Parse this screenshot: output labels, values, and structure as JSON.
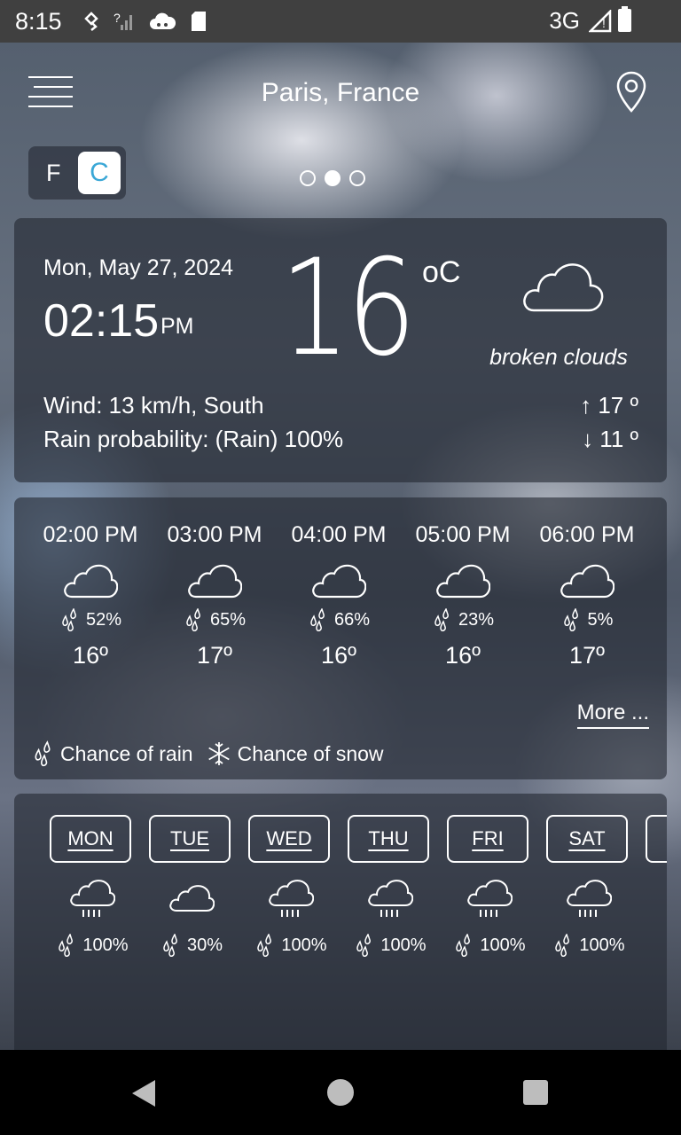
{
  "status_bar": {
    "time": "8:15",
    "network": "3G"
  },
  "header": {
    "city": "Paris, France"
  },
  "unit_toggle": {
    "f": "F",
    "c": "C",
    "selected": "C"
  },
  "pager": {
    "count": 3,
    "active_index": 1
  },
  "current": {
    "date": "Mon, May 27, 2024",
    "time": "02:15",
    "ampm": "PM",
    "temperature": "16",
    "unit": "oC",
    "condition": "broken clouds",
    "wind": "Wind: 13 km/h, South",
    "rain_probability": "Rain probability: (Rain) 100%",
    "high": "↑ 17 º",
    "low": "↓ 11 º",
    "icon": "cloud-icon"
  },
  "hourly": {
    "items": [
      {
        "time": "02:00 PM",
        "rain": "52%",
        "temp": "16º",
        "icon": "cloud-icon"
      },
      {
        "time": "03:00 PM",
        "rain": "65%",
        "temp": "17º",
        "icon": "cloud-icon"
      },
      {
        "time": "04:00 PM",
        "rain": "66%",
        "temp": "16º",
        "icon": "cloud-icon"
      },
      {
        "time": "05:00 PM",
        "rain": "23%",
        "temp": "16º",
        "icon": "cloud-icon"
      },
      {
        "time": "06:00 PM",
        "rain": "5%",
        "temp": "17º",
        "icon": "cloud-icon"
      }
    ],
    "more_label": "More ...",
    "legend_rain": "Chance of rain",
    "legend_snow": "Chance of snow"
  },
  "daily": {
    "items": [
      {
        "day": "MON",
        "rain": "100%",
        "icon": "rain-cloud-icon"
      },
      {
        "day": "TUE",
        "rain": "30%",
        "icon": "cloud-icon"
      },
      {
        "day": "WED",
        "rain": "100%",
        "icon": "rain-cloud-icon"
      },
      {
        "day": "THU",
        "rain": "100%",
        "icon": "rain-cloud-icon"
      },
      {
        "day": "FRI",
        "rain": "100%",
        "icon": "rain-cloud-icon"
      },
      {
        "day": "SAT",
        "rain": "100%",
        "icon": "rain-cloud-icon"
      }
    ]
  }
}
